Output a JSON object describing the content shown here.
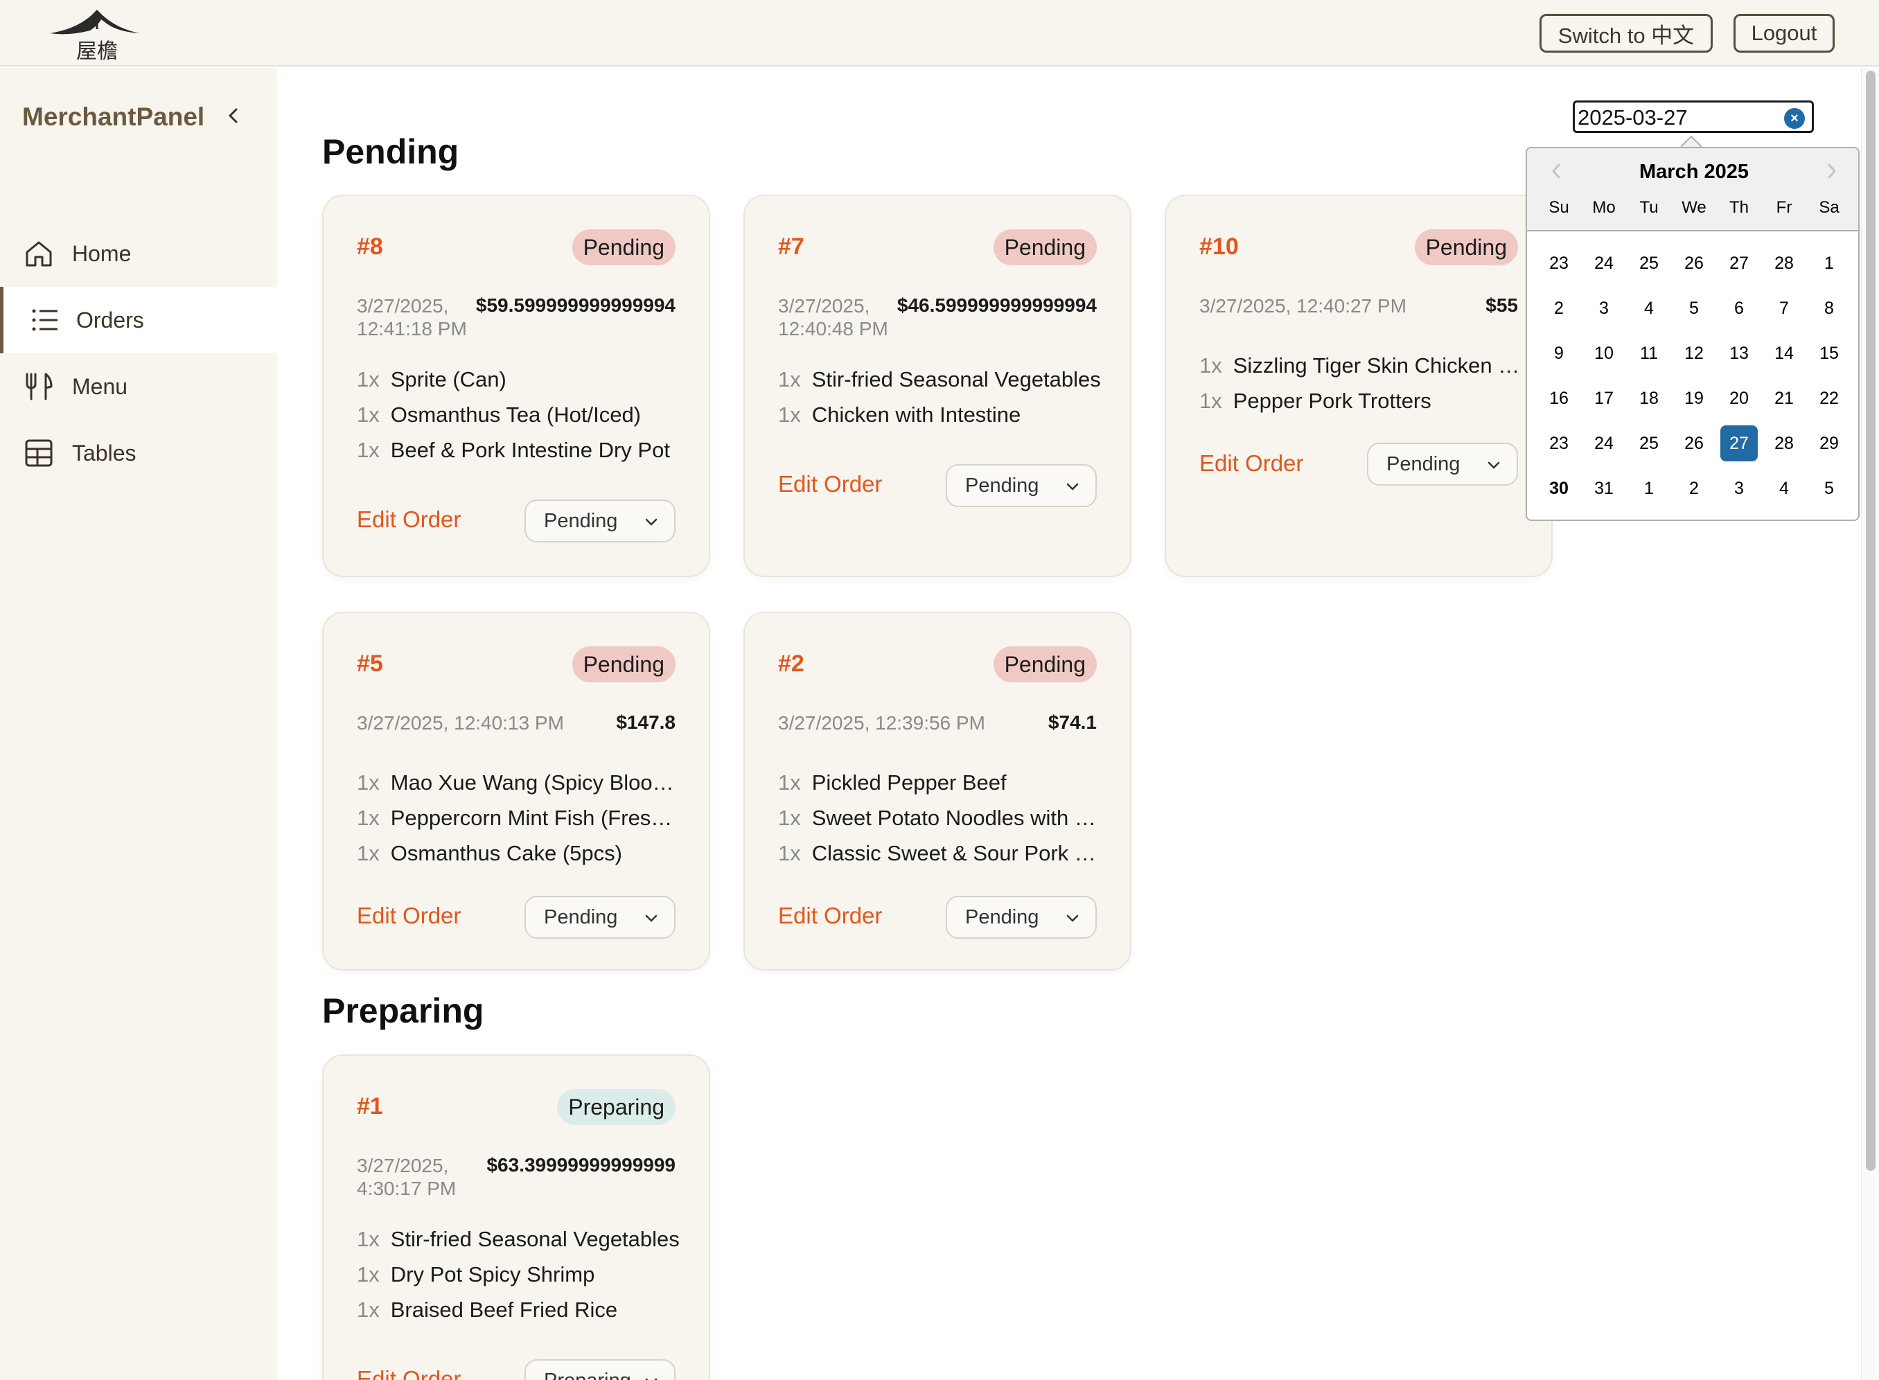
{
  "header": {
    "lang_button": "Switch to 中文",
    "logout_button": "Logout"
  },
  "sidebar": {
    "brand": "MerchantPanel",
    "items": [
      {
        "label": "Home",
        "icon": "home-icon",
        "active": false
      },
      {
        "label": "Orders",
        "icon": "list-icon",
        "active": true
      },
      {
        "label": "Menu",
        "icon": "utensils-icon",
        "active": false
      },
      {
        "label": "Tables",
        "icon": "table-icon",
        "active": false
      }
    ]
  },
  "main": {
    "sections": {
      "pending": "Pending",
      "preparing": "Preparing"
    },
    "date_filter": {
      "value": "2025-03-27"
    },
    "edit_label": "Edit Order",
    "orders": [
      {
        "id": "#8",
        "status": "Pending",
        "time_line1": "3/27/2025,",
        "time_line2": "12:41:18 PM",
        "amount": "$59.599999999999994",
        "select_value": "Pending",
        "items": [
          {
            "qty": "1x",
            "name": "Sprite (Can)"
          },
          {
            "qty": "1x",
            "name": "Osmanthus Tea (Hot/Iced)"
          },
          {
            "qty": "1x",
            "name": "Beef & Pork Intestine Dry Pot"
          }
        ]
      },
      {
        "id": "#7",
        "status": "Pending",
        "time_line1": "3/27/2025,",
        "time_line2": "12:40:48 PM",
        "amount": "$46.599999999999994",
        "select_value": "Pending",
        "items": [
          {
            "qty": "1x",
            "name": "Stir-fried Seasonal Vegetables"
          },
          {
            "qty": "1x",
            "name": "Chicken with Intestine"
          }
        ]
      },
      {
        "id": "#10",
        "status": "Pending",
        "time_line1": "3/27/2025, 12:40:27 PM",
        "time_line2": "",
        "amount": "$55",
        "select_value": "Pending",
        "items": [
          {
            "qty": "1x",
            "name": "Sizzling Tiger Skin Chicken …"
          },
          {
            "qty": "1x",
            "name": "Pepper Pork Trotters"
          }
        ]
      },
      {
        "id": "#5",
        "status": "Pending",
        "time_line1": "3/27/2025, 12:40:13 PM",
        "time_line2": "",
        "amount": "$147.8",
        "select_value": "Pending",
        "items": [
          {
            "qty": "1x",
            "name": "Mao Xue Wang (Spicy Bloo…"
          },
          {
            "qty": "1x",
            "name": "Peppercorn Mint Fish (Fres…"
          },
          {
            "qty": "1x",
            "name": "Osmanthus Cake (5pcs)"
          }
        ]
      },
      {
        "id": "#2",
        "status": "Pending",
        "time_line1": "3/27/2025, 12:39:56 PM",
        "time_line2": "",
        "amount": "$74.1",
        "select_value": "Pending",
        "items": [
          {
            "qty": "1x",
            "name": "Pickled Pepper Beef"
          },
          {
            "qty": "1x",
            "name": "Sweet Potato Noodles with …"
          },
          {
            "qty": "1x",
            "name": "Classic Sweet & Sour Pork …"
          }
        ]
      },
      {
        "id": "#1",
        "status": "Preparing",
        "time_line1": "3/27/2025,",
        "time_line2": "4:30:17 PM",
        "amount": "$63.39999999999999",
        "select_value": "Preparing",
        "items": [
          {
            "qty": "1x",
            "name": "Stir-fried Seasonal Vegetables"
          },
          {
            "qty": "1x",
            "name": "Dry Pot Spicy Shrimp"
          },
          {
            "qty": "1x",
            "name": "Braised Beef Fried Rice"
          }
        ]
      }
    ]
  },
  "calendar": {
    "month_label": "March 2025",
    "weekdays": [
      "Su",
      "Mo",
      "Tu",
      "We",
      "Th",
      "Fr",
      "Sa"
    ],
    "weeks": [
      [
        "23",
        "24",
        "25",
        "26",
        "27",
        "28",
        "1"
      ],
      [
        "2",
        "3",
        "4",
        "5",
        "6",
        "7",
        "8"
      ],
      [
        "9",
        "10",
        "11",
        "12",
        "13",
        "14",
        "15"
      ],
      [
        "16",
        "17",
        "18",
        "19",
        "20",
        "21",
        "22"
      ],
      [
        "23",
        "24",
        "25",
        "26",
        "27",
        "28",
        "29"
      ],
      [
        "30",
        "31",
        "1",
        "2",
        "3",
        "4",
        "5"
      ]
    ],
    "selected_day": "27",
    "bold_day": "30",
    "accent": "#216ba5"
  },
  "colors": {
    "accent_orange": "#e0571d",
    "sidebar_bg": "#f8f4ee",
    "pending_badge": "#f0c9c4",
    "preparing_badge": "#dcecea"
  }
}
